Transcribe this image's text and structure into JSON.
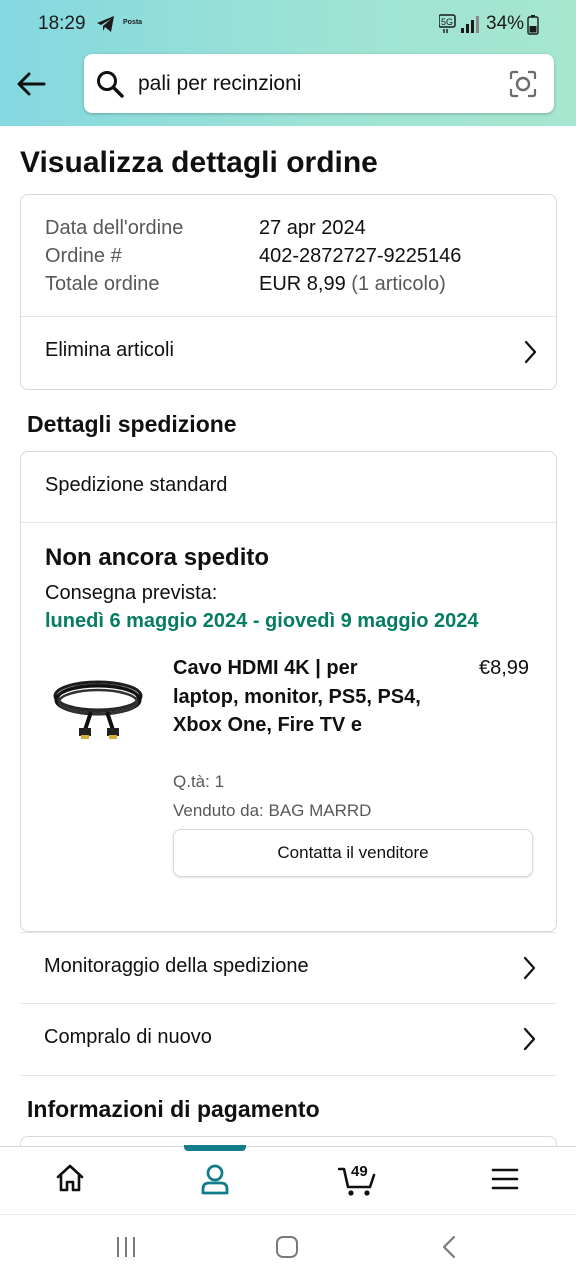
{
  "status_bar": {
    "time": "18:29",
    "posta_label": "Posta",
    "network": "5G",
    "battery": "34%"
  },
  "search": {
    "query": "pali per recinzioni"
  },
  "page_title": "Visualizza dettagli ordine",
  "order_summary": {
    "date_label": "Data dell'ordine",
    "date_value": "27 apr 2024",
    "order_label": "Ordine #",
    "order_value": "402-2872727-9225146",
    "total_label": "Totale ordine",
    "total_value": "EUR 8,99",
    "total_items": "(1 articolo)",
    "delete_items": "Elimina articoli"
  },
  "shipping": {
    "heading": "Dettagli spedizione",
    "type": "Spedizione standard",
    "status": "Non ancora spedito",
    "delivery_label": "Consegna prevista:",
    "delivery_dates": "lunedì 6 maggio 2024 - giovedì 9 maggio 2024",
    "product": {
      "name": "Cavo HDMI 4K | per laptop, monitor, PS5, PS4, Xbox One, Fire TV e",
      "price": "€8,99",
      "qty": "Q.tà: 1",
      "seller": "Venduto da: BAG MARRD",
      "contact_button": "Contatta il venditore"
    }
  },
  "actions": {
    "tracking": "Monitoraggio della spedizione",
    "buy_again": "Compralo di nuovo"
  },
  "payment": {
    "heading": "Informazioni di pagamento"
  },
  "bottom_nav": {
    "cart_count": "49"
  },
  "colors": {
    "header_gradient_start": "#84d8e0",
    "header_gradient_end": "#a6e6cf",
    "delivery_green": "#067d62",
    "nav_indicator": "#137c8b"
  }
}
